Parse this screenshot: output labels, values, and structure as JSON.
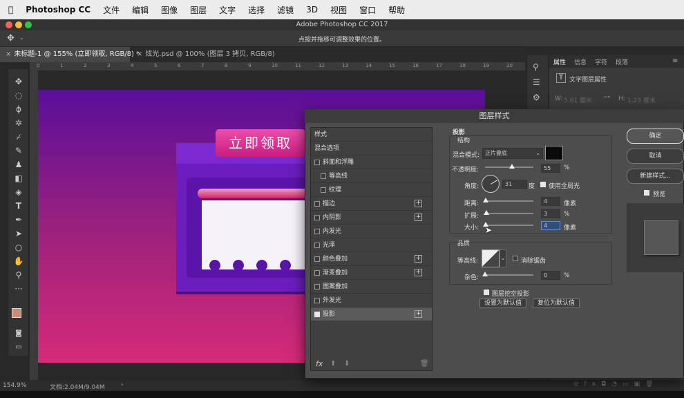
{
  "menu": {
    "apple": "",
    "app": "Photoshop CC",
    "items": [
      "文件",
      "编辑",
      "图像",
      "图层",
      "文字",
      "选择",
      "滤镜",
      "3D",
      "视图",
      "窗口",
      "帮助"
    ]
  },
  "window_title": "Adobe Photoshop CC 2017",
  "options_hint": "点按并拖移可调整效果的位置。",
  "tabs": [
    {
      "label": "未标题-1 @ 155% (立即领取, RGB/8) *"
    },
    {
      "label": "炫光.psd @ 100% (图层 3 拷贝, RGB/8)"
    }
  ],
  "ruler_ticks": [
    "0",
    "1",
    "2",
    "3",
    "4",
    "5",
    "6",
    "7",
    "8",
    "9",
    "10",
    "11",
    "12",
    "13",
    "14",
    "15",
    "16",
    "17",
    "18",
    "19",
    "20"
  ],
  "artwork": {
    "button_text": "立即领取"
  },
  "statusbar": {
    "zoom": "154.9%",
    "doc": "文档:2.04M/9.04M"
  },
  "properties": {
    "tabs": [
      "属性",
      "信息",
      "字符",
      "段落"
    ],
    "type_label": "文字图层属性",
    "w_label": "W:",
    "w_value": "5.61 厘米",
    "h_label": "H:",
    "h_value": "1.23 厘米"
  },
  "dialog": {
    "title": "图层样式",
    "styles_header": "样式",
    "blend_options": "混合选项",
    "items": [
      {
        "label": "斜面和浮雕",
        "checked": false,
        "plus": false,
        "indent": false
      },
      {
        "label": "等高线",
        "checked": false,
        "plus": false,
        "indent": true
      },
      {
        "label": "纹理",
        "checked": false,
        "plus": false,
        "indent": true
      },
      {
        "label": "描边",
        "checked": false,
        "plus": true,
        "indent": false
      },
      {
        "label": "内阴影",
        "checked": false,
        "plus": true,
        "indent": false
      },
      {
        "label": "内发光",
        "checked": false,
        "plus": false,
        "indent": false
      },
      {
        "label": "光泽",
        "checked": false,
        "plus": false,
        "indent": false
      },
      {
        "label": "颜色叠加",
        "checked": false,
        "plus": true,
        "indent": false
      },
      {
        "label": "渐变叠加",
        "checked": false,
        "plus": true,
        "indent": false
      },
      {
        "label": "图案叠加",
        "checked": false,
        "plus": false,
        "indent": false
      },
      {
        "label": "外发光",
        "checked": false,
        "plus": false,
        "indent": false
      },
      {
        "label": "投影",
        "checked": true,
        "plus": true,
        "indent": false
      }
    ],
    "fx_label": "fx",
    "section": "投影",
    "structure": "结构",
    "blend_mode_label": "混合模式:",
    "blend_mode_value": "正片叠底",
    "shadow_color": "#0a0a0a",
    "opacity_label": "不透明度:",
    "opacity_value": "55",
    "opacity_unit": "%",
    "opacity_fraction": 0.55,
    "angle_label": "角度:",
    "angle_value": "31",
    "angle_unit": "度",
    "global_light_label": "使用全局光",
    "global_light": true,
    "distance_label": "距离:",
    "distance_value": "4",
    "distance_unit": "像素",
    "distance_fraction": 0.02,
    "spread_label": "扩展:",
    "spread_value": "3",
    "spread_unit": "%",
    "spread_fraction": 0.03,
    "size_label": "大小:",
    "size_value": "4",
    "size_unit": "像素",
    "size_fraction": 0.02,
    "quality": "品质",
    "contour_label": "等高线:",
    "anti_alias_label": "消除锯齿",
    "noise_label": "杂色:",
    "noise_value": "0",
    "noise_unit": "%",
    "noise_fraction": 0.0,
    "knockout_label": "图层挖空投影",
    "knockout": true,
    "set_default": "设置为默认值",
    "reset_default": "复位为默认值",
    "ok": "确定",
    "cancel": "取消",
    "new_style": "新建样式...",
    "preview_label": "预览"
  }
}
